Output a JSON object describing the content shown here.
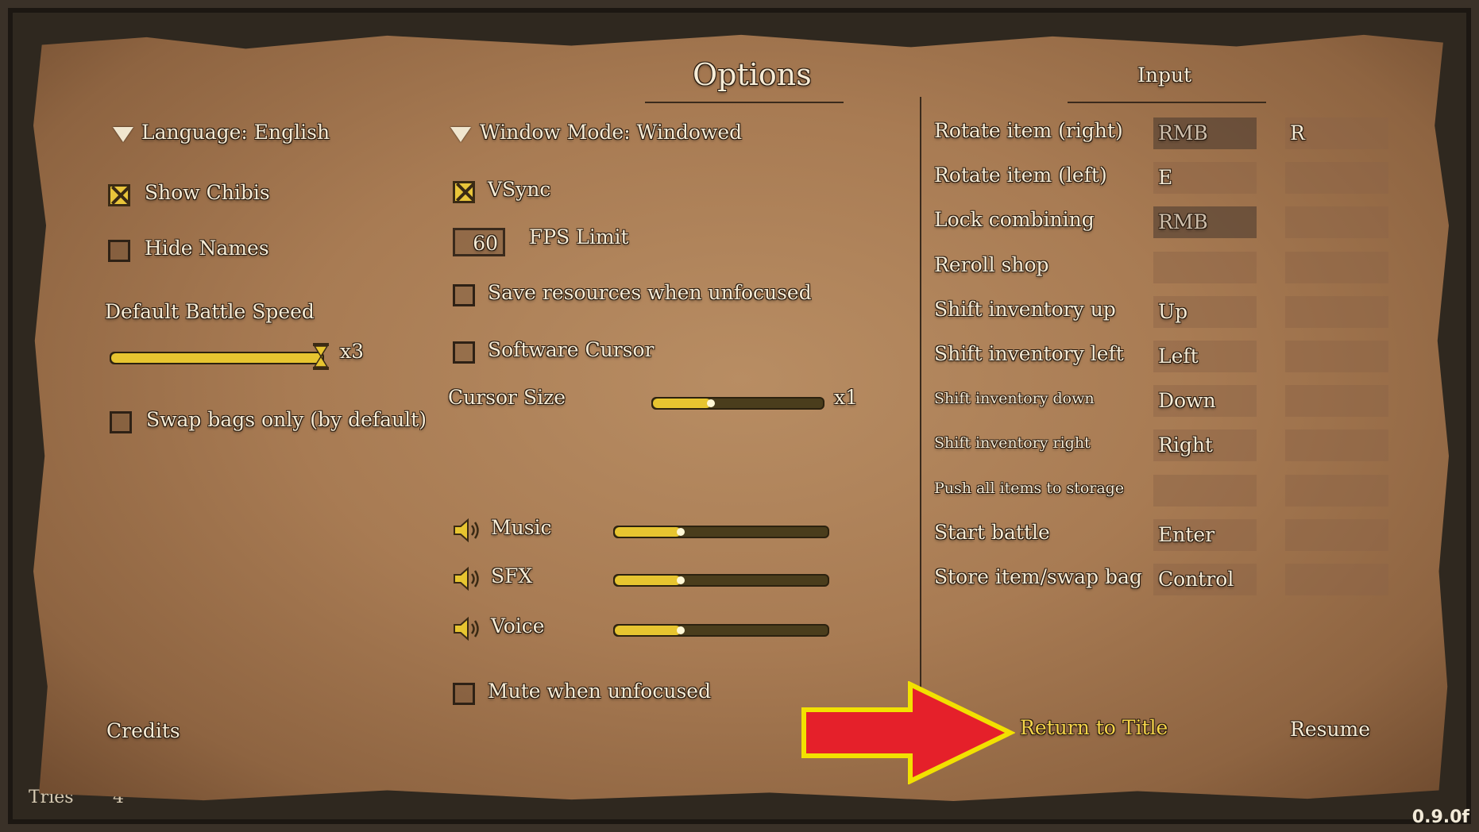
{
  "title": "Options",
  "input_heading": "Input",
  "left": {
    "language": "Language: English",
    "show_chibis": {
      "label": "Show Chibis",
      "checked": true
    },
    "hide_names": {
      "label": "Hide Names",
      "checked": false
    },
    "battle_speed_label": "Default Battle Speed",
    "battle_speed_value": "x3",
    "battle_speed_fraction": 1.0,
    "swap_bags": {
      "label": "Swap bags only (by default)",
      "checked": false
    },
    "credits": "Credits"
  },
  "middle": {
    "window_mode": "Window Mode: Windowed",
    "vsync": {
      "label": "VSync",
      "checked": true
    },
    "fps_value": "60",
    "fps_label": "FPS Limit",
    "save_resources": {
      "label": "Save resources when unfocused",
      "checked": false
    },
    "software_cursor": {
      "label": "Software Cursor",
      "checked": false
    },
    "cursor_size_label": "Cursor Size",
    "cursor_size_value": "x1",
    "cursor_size_fraction": 0.34,
    "music": {
      "label": "Music",
      "fraction": 0.31
    },
    "sfx": {
      "label": "SFX",
      "fraction": 0.31
    },
    "voice": {
      "label": "Voice",
      "fraction": 0.31
    },
    "mute_unfocused": {
      "label": "Mute when unfocused",
      "checked": false
    }
  },
  "bindings": [
    {
      "action": "Rotate item (right)",
      "primary": "RMB",
      "secondary": "R",
      "primary_default": true,
      "small": false
    },
    {
      "action": "Rotate item (left)",
      "primary": "E",
      "secondary": "",
      "primary_default": false,
      "small": false
    },
    {
      "action": "Lock combining",
      "primary": "RMB",
      "secondary": "",
      "primary_default": true,
      "small": false
    },
    {
      "action": "Reroll shop",
      "primary": "",
      "secondary": "",
      "primary_default": false,
      "small": false
    },
    {
      "action": "Shift inventory up",
      "primary": "Up",
      "secondary": "",
      "primary_default": false,
      "small": false
    },
    {
      "action": "Shift inventory left",
      "primary": "Left",
      "secondary": "",
      "primary_default": false,
      "small": false
    },
    {
      "action": "Shift inventory down",
      "primary": "Down",
      "secondary": "",
      "primary_default": false,
      "small": true
    },
    {
      "action": "Shift inventory right",
      "primary": "Right",
      "secondary": "",
      "primary_default": false,
      "small": true
    },
    {
      "action": "Push all items to storage",
      "primary": "",
      "secondary": "",
      "primary_default": false,
      "small": true
    },
    {
      "action": "Start battle",
      "primary": "Enter",
      "secondary": "",
      "primary_default": false,
      "small": false
    },
    {
      "action": "Store item/swap bag",
      "primary": "Control",
      "secondary": "",
      "primary_default": false,
      "small": false
    }
  ],
  "footer": {
    "return_to_title": "Return to Title",
    "resume": "Resume"
  },
  "background": {
    "tries_label": "Tries",
    "tries_count": "4"
  },
  "version": "0.9.0f",
  "colors": {
    "accent_yellow": "#e7c530",
    "highlight_text": "#f5d44a",
    "arrow_red": "#e5202a",
    "arrow_outline": "#f2e100"
  }
}
